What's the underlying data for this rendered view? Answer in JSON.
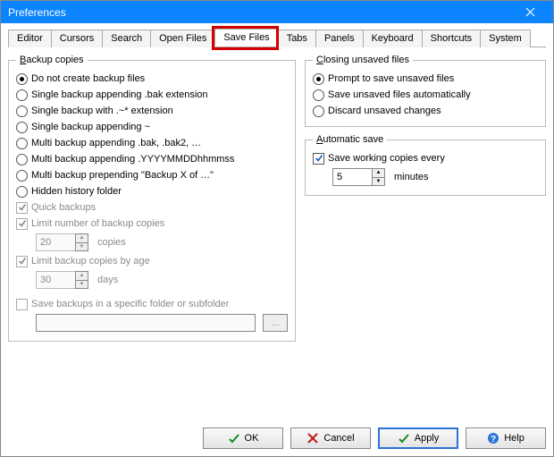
{
  "title": "Preferences",
  "tabs": [
    "Editor",
    "Cursors",
    "Search",
    "Open Files",
    "Save Files",
    "Tabs",
    "Panels",
    "Keyboard",
    "Shortcuts",
    "System"
  ],
  "active_tab_index": 4,
  "backup": {
    "legend_underline": "B",
    "legend_rest": "ackup copies",
    "radios": [
      "Do not create backup files",
      "Single backup appending .bak extension",
      "Single backup with .~* extension",
      "Single backup appending ~",
      "Multi backup appending .bak, .bak2, …",
      "Multi backup appending .YYYYMMDDhhmmss",
      "Multi backup prepending \"Backup X of …\"",
      "Hidden history folder"
    ],
    "selected_radio": 0,
    "quick_backups": "Quick backups",
    "limit_copies_label": "Limit number of backup copies",
    "limit_copies_value": "20",
    "limit_copies_unit": "copies",
    "limit_age_label": "Limit backup copies by age",
    "limit_age_value": "30",
    "limit_age_unit": "days",
    "folder_label": "Save backups in a specific folder or subfolder",
    "folder_value": "",
    "browse_label": "..."
  },
  "closing": {
    "legend_underline": "C",
    "legend_rest": "losing unsaved files",
    "radios": [
      "Prompt to save unsaved files",
      "Save unsaved files automatically",
      "Discard unsaved changes"
    ],
    "selected_radio": 0
  },
  "autosave": {
    "legend_underline": "A",
    "legend_rest": "utomatic save",
    "label": "Save working copies every",
    "value": "5",
    "unit": "minutes",
    "checked": true
  },
  "buttons": {
    "ok": "OK",
    "cancel": "Cancel",
    "apply": "Apply",
    "help": "Help"
  }
}
